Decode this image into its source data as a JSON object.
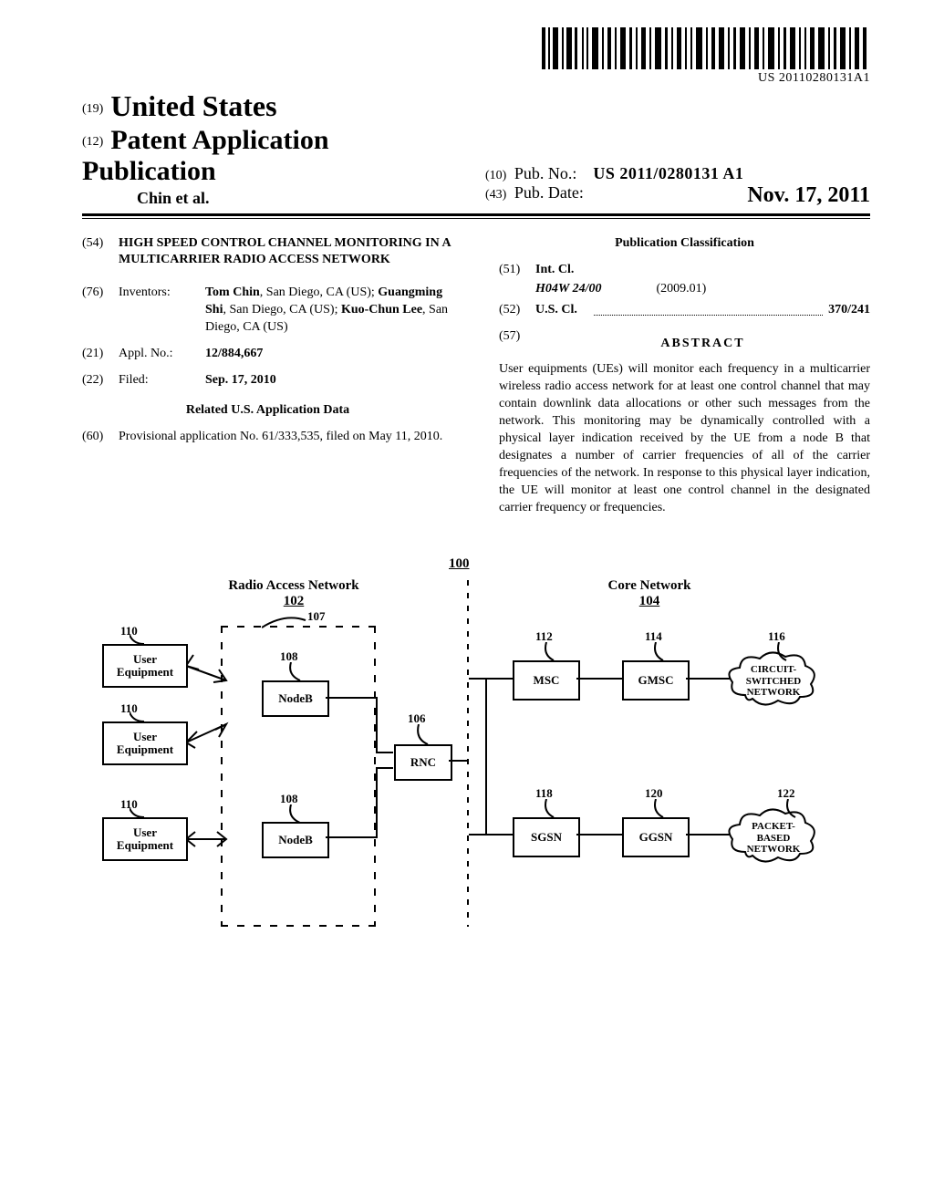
{
  "barcode_text": "US 20110280131A1",
  "header": {
    "prefix19": "(19)",
    "country": "United States",
    "prefix12": "(12)",
    "doc_type": "Patent Application Publication",
    "authors_line": "Chin et al.",
    "prefix10": "(10)",
    "pubno_label": "Pub. No.:",
    "pubno_value": "US 2011/0280131 A1",
    "prefix43": "(43)",
    "pubdate_label": "Pub. Date:",
    "pubdate_value": "Nov. 17, 2011"
  },
  "biblio": {
    "f54": {
      "num": "(54)",
      "title": "HIGH SPEED CONTROL CHANNEL MONITORING IN A MULTICARRIER RADIO ACCESS NETWORK"
    },
    "f76": {
      "num": "(76)",
      "label": "Inventors:",
      "body": "Tom Chin, San Diego, CA (US); Guangming Shi, San Diego, CA (US); Kuo-Chun Lee, San Diego, CA (US)",
      "names": [
        "Tom Chin",
        "Guangming Shi",
        "Kuo-Chun Lee"
      ]
    },
    "f21": {
      "num": "(21)",
      "label": "Appl. No.:",
      "value": "12/884,667"
    },
    "f22": {
      "num": "(22)",
      "label": "Filed:",
      "value": "Sep. 17, 2010"
    },
    "related_heading": "Related U.S. Application Data",
    "f60": {
      "num": "(60)",
      "body": "Provisional application No. 61/333,535, filed on May 11, 2010."
    },
    "pubclass_heading": "Publication Classification",
    "f51": {
      "num": "(51)",
      "label": "Int. Cl.",
      "ipc_code": "H04W 24/00",
      "ipc_date": "(2009.01)"
    },
    "f52": {
      "num": "(52)",
      "label": "U.S. Cl.",
      "value": "370/241"
    },
    "f57": {
      "num": "(57)",
      "label": "ABSTRACT"
    },
    "abstract_text": "User equipments (UEs) will monitor each frequency in a multicarrier wireless radio access network for at least one control channel that may contain downlink data allocations or other such messages from the network. This monitoring may be dynamically controlled with a physical layer indication received by the UE from a node B that designates a number of carrier frequencies of all of the carrier frequencies of the network. In response to this physical layer indication, the UE will monitor at least one control channel in the designated carrier frequency or frequencies."
  },
  "figure": {
    "ref100": "100",
    "ran_title": "Radio Access Network",
    "ran_ref": "102",
    "core_title": "Core Network",
    "core_ref": "104",
    "ref106": "106",
    "ref107": "107",
    "ref108a": "108",
    "ref108b": "108",
    "ref110a": "110",
    "ref110b": "110",
    "ref110c": "110",
    "ref112": "112",
    "ref114": "114",
    "ref116": "116",
    "ref118": "118",
    "ref120": "120",
    "ref122": "122",
    "ue": "User\nEquipment",
    "nodeb": "NodeB",
    "rnc": "RNC",
    "msc": "MSC",
    "gmsc": "GMSC",
    "sgsn": "SGSN",
    "ggsn": "GGSN",
    "circuit_net": "CIRCUIT-\nSWITCHED\nNETWORK",
    "packet_net": "PACKET-\nBASED\nNETWORK"
  }
}
